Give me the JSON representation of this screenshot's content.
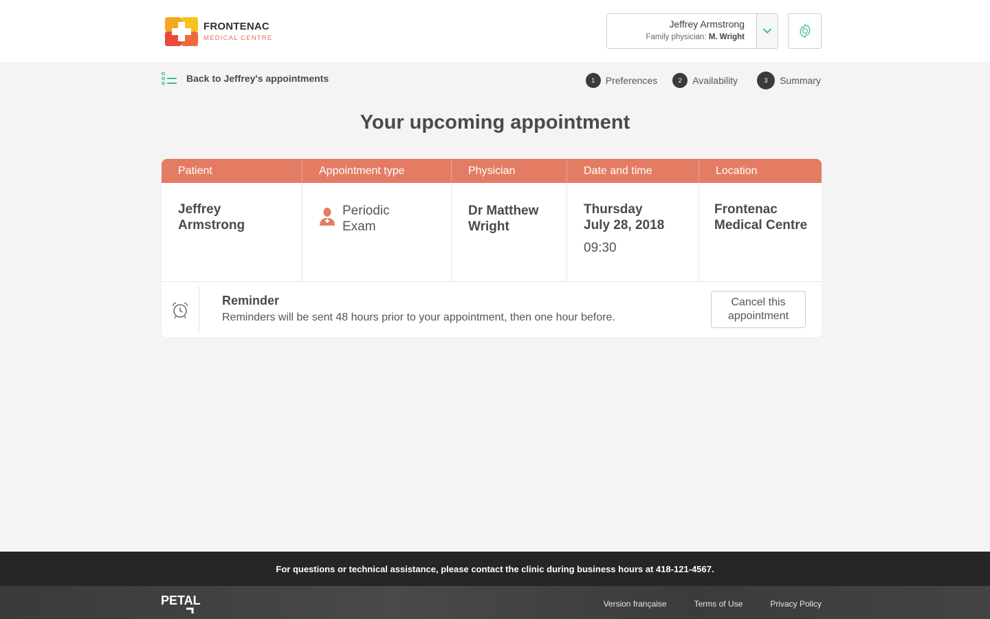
{
  "header": {
    "logo": {
      "name": "FRONTENAC",
      "subtitle": "MEDICAL CENTRE",
      "colors": {
        "orange": "#f5a623",
        "red": "#e84a3c",
        "text_accent": "#e2705a"
      }
    },
    "user": {
      "name": "Jeffrey Armstrong",
      "physician_label": "Family physician:",
      "physician_name": "M. Wright",
      "toggle_icon": "chevron-down-icon"
    },
    "settings_icon": "gear-icon"
  },
  "nav": {
    "back_label": "Back to Jeffrey's appointments",
    "steps": [
      {
        "number": "1",
        "label": "Preferences"
      },
      {
        "number": "2",
        "label": "Availability"
      },
      {
        "number": "3",
        "label": "Summary"
      }
    ]
  },
  "main": {
    "title": "Your upcoming appointment",
    "table": {
      "headers": [
        "Patient",
        "Appointment type",
        "Physician",
        "Date and time",
        "Location"
      ],
      "patient": {
        "first": "Jeffrey",
        "last": "Armstrong"
      },
      "appointment_type": {
        "line1": "Periodic",
        "line2": "Exam",
        "icon": "doctor-icon"
      },
      "physician": {
        "line1": "Dr Matthew",
        "line2": "Wright"
      },
      "date_time": {
        "day": "Thursday",
        "date": "July 28, 2018",
        "time": "09:30"
      },
      "location": {
        "line1": "Frontenac",
        "line2": "Medical Centre"
      }
    },
    "reminder": {
      "icon": "alarm-clock-icon",
      "title": "Reminder",
      "text": "Reminders will be sent 48 hours prior to your appointment, then one hour before."
    },
    "cancel_label": "Cancel this appointment"
  },
  "footer": {
    "help_text": "For questions or technical assistance, please contact the clinic during business hours at 418-121-4567.",
    "brand": "PETAL",
    "links": [
      "Version française",
      "Terms of Use",
      "Privacy Policy"
    ]
  },
  "colors": {
    "accent_teal": "#3fb8a5",
    "table_header": "#e47c64",
    "background": "#f4f4f4"
  }
}
